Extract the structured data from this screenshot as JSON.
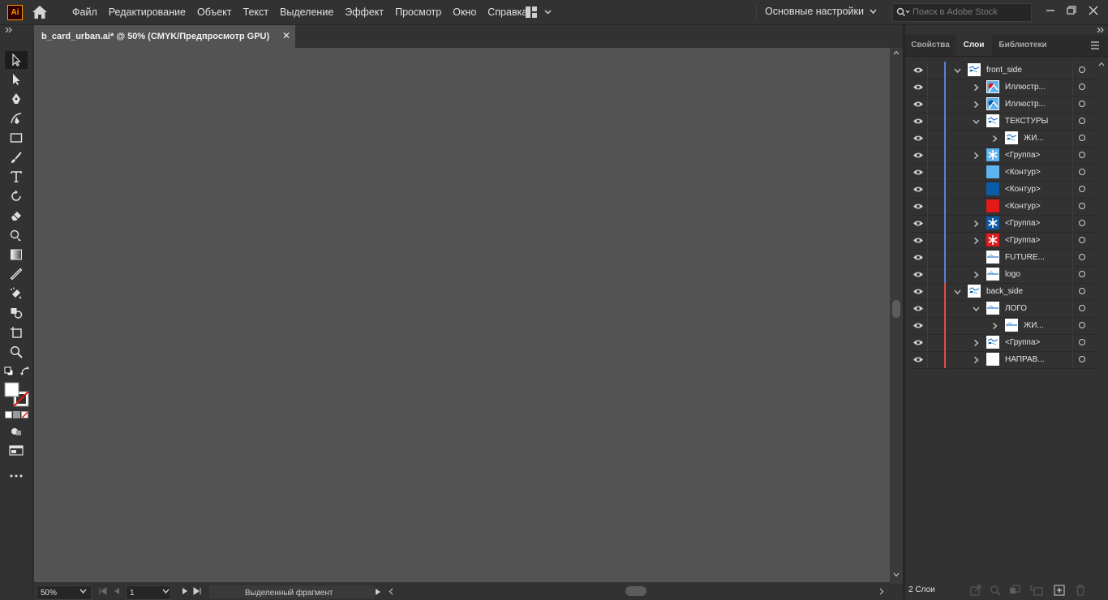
{
  "app": {
    "logo_text": "Ai"
  },
  "menu": [
    "Файл",
    "Редактирование",
    "Объект",
    "Текст",
    "Выделение",
    "Эффект",
    "Просмотр",
    "Окно",
    "Справка"
  ],
  "workspace": {
    "label": "Основные настройки"
  },
  "search": {
    "placeholder": "Поиск в Adobe Stock"
  },
  "document": {
    "tab_title": "b_card_urban.ai* @ 50% (CMYK/Предпросмотр GPU)",
    "close_glyph": "✕"
  },
  "status": {
    "zoom": "50%",
    "page": "1",
    "selection": "Выделенный фрагмент"
  },
  "panel": {
    "tabs": [
      "Свойства",
      "Слои",
      "Библиотеки"
    ],
    "active_tab": "Слои",
    "layer_count": "2 Слои"
  },
  "colors": {
    "front_side_layer": "#5b7ed8",
    "back_side_layer": "#e04a4a",
    "accent_light_blue": "#5eb4ee",
    "accent_dark_blue": "#0b5ca8",
    "accent_red": "#e21a1a"
  },
  "layers": [
    {
      "name": "front_side",
      "level": 0,
      "expanded": true,
      "has_children": true,
      "thumb": "white-artwork",
      "layer": "front"
    },
    {
      "name": "Иллюстр...",
      "level": 1,
      "expanded": false,
      "has_children": true,
      "thumb": "illustration-red",
      "layer": "front"
    },
    {
      "name": "Иллюстр...",
      "level": 1,
      "expanded": false,
      "has_children": true,
      "thumb": "illustration-blue",
      "layer": "front"
    },
    {
      "name": "ТЕКСТУРЫ",
      "level": 1,
      "expanded": true,
      "has_children": true,
      "thumb": "white-artwork",
      "layer": "front"
    },
    {
      "name": "ЖИ...",
      "level": 2,
      "expanded": false,
      "has_children": true,
      "thumb": "white-artwork",
      "layer": "front"
    },
    {
      "name": "<Группа>",
      "level": 1,
      "expanded": false,
      "has_children": true,
      "thumb": "snowflake-light",
      "layer": "front"
    },
    {
      "name": "<Контур>",
      "level": 1,
      "expanded": false,
      "has_children": false,
      "thumb": "swatch-light-blue",
      "layer": "front"
    },
    {
      "name": "<Контур>",
      "level": 1,
      "expanded": false,
      "has_children": false,
      "thumb": "swatch-dark-blue",
      "layer": "front"
    },
    {
      "name": "<Контур>",
      "level": 1,
      "expanded": false,
      "has_children": false,
      "thumb": "swatch-red",
      "layer": "front"
    },
    {
      "name": "<Группа>",
      "level": 1,
      "expanded": false,
      "has_children": true,
      "thumb": "snowflake-dark",
      "layer": "front"
    },
    {
      "name": "<Группа>",
      "level": 1,
      "expanded": false,
      "has_children": true,
      "thumb": "snowflake-red",
      "layer": "front"
    },
    {
      "name": "FUTURE...",
      "level": 1,
      "expanded": false,
      "has_children": false,
      "thumb": "white-line",
      "layer": "front"
    },
    {
      "name": "logo",
      "level": 1,
      "expanded": false,
      "has_children": true,
      "thumb": "white-line",
      "layer": "front"
    },
    {
      "name": "back_side",
      "level": 0,
      "expanded": true,
      "has_children": true,
      "thumb": "white-artwork",
      "layer": "back"
    },
    {
      "name": "ЛОГО",
      "level": 1,
      "expanded": true,
      "has_children": true,
      "thumb": "white-line",
      "layer": "back"
    },
    {
      "name": "ЖИ...",
      "level": 2,
      "expanded": false,
      "has_children": true,
      "thumb": "white-line",
      "layer": "back"
    },
    {
      "name": "<Группа>",
      "level": 1,
      "expanded": false,
      "has_children": true,
      "thumb": "white-artwork",
      "layer": "back"
    },
    {
      "name": "НАПРАВ...",
      "level": 1,
      "expanded": false,
      "has_children": true,
      "thumb": "white-plain",
      "layer": "back"
    }
  ]
}
